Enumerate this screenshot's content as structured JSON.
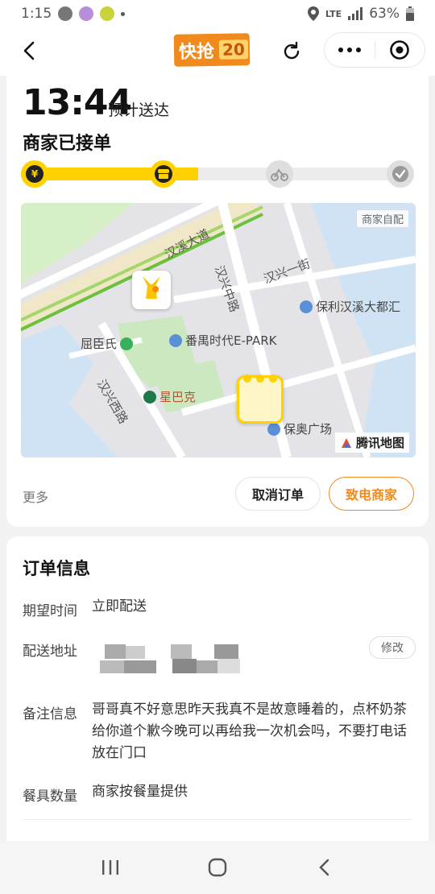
{
  "status_bar": {
    "time": "1:15",
    "network": "LTE",
    "battery": "63%"
  },
  "header": {
    "logo_text": "快抢",
    "logo_badge": "20",
    "icons": [
      "back-arrow-icon",
      "refresh-icon",
      "more-dots-icon",
      "close-target-icon"
    ]
  },
  "order_status": {
    "eta_time": "13:44",
    "eta_label": "预计送达",
    "status_title": "商家已接单",
    "progress_fraction": 0.45,
    "steps": [
      "paid-icon",
      "merchant-icon",
      "rider-icon",
      "delivered-icon"
    ]
  },
  "map": {
    "badge": "商家自配",
    "brand": "腾讯地图",
    "roads": [
      "汉溪大道",
      "汉兴中路",
      "汉兴一街",
      "汉兴西路"
    ],
    "pois": [
      "保利汉溪大都汇",
      "屈臣氏",
      "番禺时代E-PARK",
      "星巴克",
      "保奥广场"
    ]
  },
  "actions": {
    "more": "更多",
    "cancel": "取消订单",
    "call": "致电商家"
  },
  "order_info": {
    "title": "订单信息",
    "expected_time_label": "期望时间",
    "expected_time_value": "立即配送",
    "address_label": "配送地址",
    "edit": "修改",
    "remark_label": "备注信息",
    "remark_value": "哥哥真不好意思昨天我真不是故意睡着的，点杯奶茶给你道个歉今晚可以再给我一次机会吗，不要打电话放在门口",
    "tableware_label": "餐具数量",
    "tableware_value": "商家按餐量提供"
  },
  "colors": {
    "accent_yellow": "#ffd100",
    "accent_orange": "#f08a1c"
  }
}
